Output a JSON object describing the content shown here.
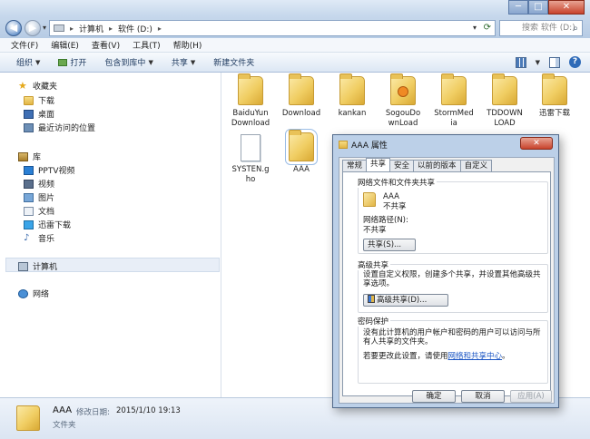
{
  "address": {
    "segments": [
      "计算机",
      "软件 (D:)"
    ]
  },
  "search": {
    "placeholder": "搜索 软件 (D:)"
  },
  "window_controls": {
    "minimize": "─",
    "maximize": "□",
    "close": "✕"
  },
  "menubar": [
    "文件(F)",
    "编辑(E)",
    "查看(V)",
    "工具(T)",
    "帮助(H)"
  ],
  "toolbar": {
    "organize": "组织",
    "open": "打开",
    "include_library": "包含到库中",
    "share": "共享",
    "new_folder": "新建文件夹"
  },
  "navpane": {
    "favorites": "收藏夹",
    "downloads": "下载",
    "desktop": "桌面",
    "recent": "最近访问的位置",
    "libraries": "库",
    "lib_items": [
      "PPTV视频",
      "视频",
      "图片",
      "文档",
      "迅雷下载",
      "音乐"
    ],
    "computer": "计算机",
    "network": "网络"
  },
  "files": [
    {
      "name": "BaiduYun\nDownload",
      "type": "folder"
    },
    {
      "name": "Download",
      "type": "folder"
    },
    {
      "name": "kankan",
      "type": "folder"
    },
    {
      "name": "SogouDo\nwnLoad",
      "type": "folder"
    },
    {
      "name": "StormMed\nia",
      "type": "folder"
    },
    {
      "name": "TDDOWN\nLOAD",
      "type": "folder"
    },
    {
      "name": "迅雷下载",
      "type": "folder"
    },
    {
      "name": "SYSTEN.g\nho",
      "type": "file"
    },
    {
      "name": "AAA",
      "type": "folder",
      "selected": true
    }
  ],
  "status": {
    "name": "AAA",
    "date_label": "修改日期:",
    "date": "2015/1/10 19:13",
    "type": "文件夹"
  },
  "dialog": {
    "title": "AAA 属性",
    "close": "✕",
    "tabs": [
      "常规",
      "共享",
      "安全",
      "以前的版本",
      "自定义"
    ],
    "active_tab": "共享",
    "sharing": {
      "group": "网络文件和文件夹共享",
      "folder_name": "AAA",
      "state": "不共享",
      "path_label": "网络路径(N):",
      "path_value": "不共享",
      "share_button": "共享(S)..."
    },
    "advanced": {
      "group": "高级共享",
      "desc": "设置自定义权限，创建多个共享，并设置其他高级共享选项。",
      "button": "高级共享(D)..."
    },
    "password": {
      "group": "密码保护",
      "desc": "没有此计算机的用户帐户和密码的用户可以访问与所有人共享的文件夹。",
      "hint_prefix": "若要更改此设置，请使用",
      "link": "网络和共享中心",
      "hint_suffix": "。"
    },
    "buttons": {
      "ok": "确定",
      "cancel": "取消",
      "apply": "应用(A)"
    }
  }
}
